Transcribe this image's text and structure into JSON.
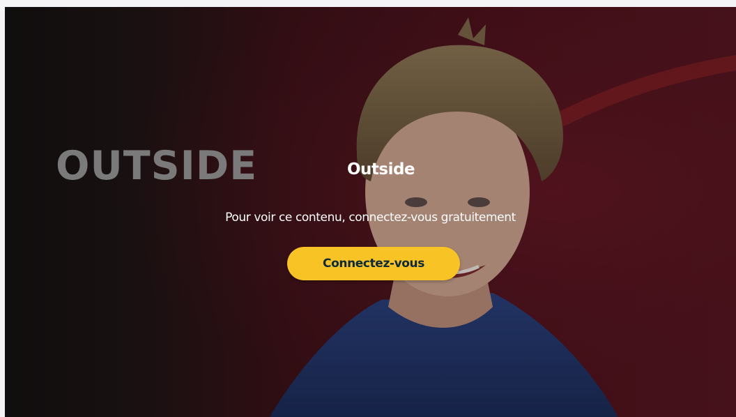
{
  "hero": {
    "show_logo": "OUTSIDE",
    "title": "Outside",
    "message": "Pour voir ce contenu, connectez-vous gratuitement",
    "login_button_label": "Connectez-vous"
  },
  "colors": {
    "background_dark": "#141212",
    "background_red": "#561520",
    "accent_button": "#f7c325",
    "button_text": "#0e2a3a",
    "logo_text": "#7a7a7a"
  },
  "image": {
    "subject": "presenter-portrait"
  }
}
